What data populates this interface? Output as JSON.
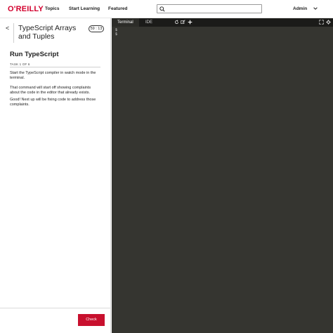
{
  "nav": {
    "logo": "O'REILLY",
    "links": [
      "Topics",
      "Start Learning",
      "Featured"
    ],
    "search_placeholder": "",
    "search_value": "",
    "user": "Admin"
  },
  "lesson": {
    "back": "<",
    "title": "TypeScript Arrays and Tuples",
    "timer": "59 : 13",
    "task_heading": "Run TypeScript",
    "task_count": "TASK 1 OF 6",
    "paragraphs": [
      "Start the TypeScript compiler in watch mode in the terminal.",
      "That command will start off showing complaints about the code in the editor that already exists.",
      "Good! Next up will be fixing code to address those complaints."
    ],
    "check": "Check"
  },
  "terminal": {
    "tabs": [
      "Terminal",
      "IDE"
    ],
    "lines": [
      "$",
      "$"
    ]
  },
  "colors": {
    "brand": "#d3002d",
    "check": "#c8102e",
    "terminal_bg": "#353530"
  }
}
